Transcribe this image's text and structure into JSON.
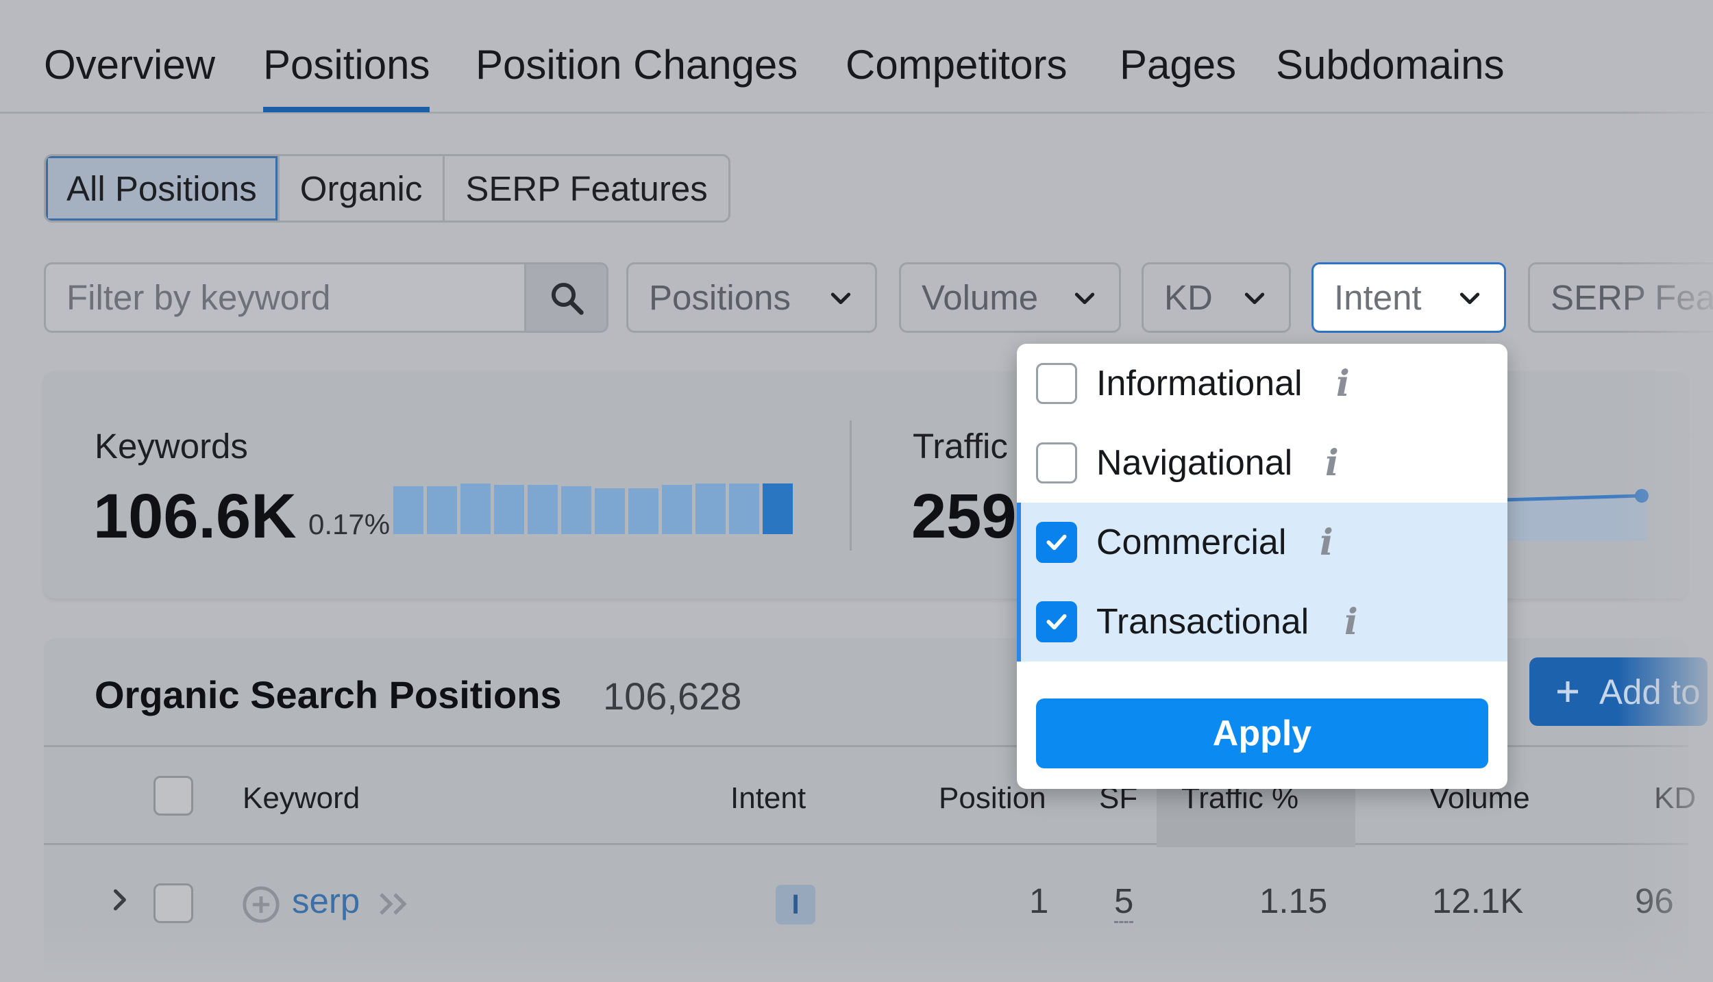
{
  "tabs": [
    {
      "label": "Overview"
    },
    {
      "label": "Positions"
    },
    {
      "label": "Position Changes"
    },
    {
      "label": "Competitors"
    },
    {
      "label": "Pages"
    },
    {
      "label": "Subdomains"
    }
  ],
  "active_tab": "Positions",
  "segmented": [
    {
      "label": "All Positions"
    },
    {
      "label": "Organic"
    },
    {
      "label": "SERP Features"
    }
  ],
  "filters": {
    "search_placeholder": "Filter by keyword",
    "positions": "Positions",
    "volume": "Volume",
    "kd": "KD",
    "intent": "Intent",
    "serp_features": "SERP Features"
  },
  "summary": {
    "keywords_label": "Keywords",
    "keywords_value": "106.6K",
    "keywords_delta": "0.17%",
    "traffic_label": "Traffic",
    "traffic_value": "259",
    "keyword_trend_bars": [
      0.58,
      0.58,
      0.62,
      0.6,
      0.6,
      0.58,
      0.56,
      0.56,
      0.6,
      0.62,
      0.62,
      0.62
    ]
  },
  "intent_dropdown": {
    "options": [
      {
        "label": "Informational",
        "checked": false
      },
      {
        "label": "Navigational",
        "checked": false
      },
      {
        "label": "Commercial",
        "checked": true
      },
      {
        "label": "Transactional",
        "checked": true
      }
    ],
    "info_glyph": "i",
    "apply_label": "Apply"
  },
  "organic": {
    "title": "Organic Search Positions",
    "count": "106,628",
    "add_label": "Add to"
  },
  "table": {
    "headers": {
      "keyword": "Keyword",
      "intent": "Intent",
      "position": "Position",
      "sf": "SF",
      "traffic": "Traffic %",
      "volume": "Volume",
      "kd": "KD"
    },
    "rows": [
      {
        "keyword": "serp",
        "intent": "I",
        "position": "1",
        "sf": "5",
        "traffic": "1.15",
        "volume": "12.1K",
        "kd": "96"
      }
    ]
  },
  "colors": {
    "accent": "#0b8af2",
    "selected_bg": "#d9ebfb",
    "tab_underline": "#1b5fa8"
  }
}
